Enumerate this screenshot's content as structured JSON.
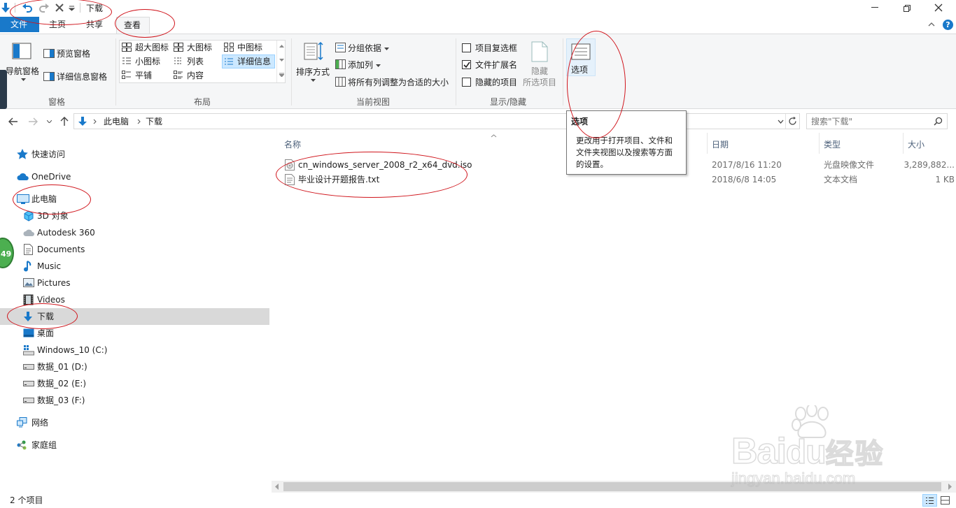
{
  "window": {
    "title": "下载"
  },
  "ribbon_tabs": [
    {
      "label": "文件"
    },
    {
      "label": "主页"
    },
    {
      "label": "共享"
    },
    {
      "label": "查看"
    }
  ],
  "ribbon": {
    "panes_group": {
      "nav_pane": "导航窗格",
      "preview_pane": "预览窗格",
      "details_pane": "详细信息窗格",
      "title": "窗格"
    },
    "layout_group": {
      "items": [
        "超大图标",
        "大图标",
        "中图标",
        "小图标",
        "列表",
        "详细信息",
        "平铺",
        "内容"
      ],
      "title": "布局"
    },
    "current_view_group": {
      "sort_by": "排序方式",
      "group_by": "分组依据",
      "add_columns": "添加列",
      "size_columns": "将所有列调整为合适的大小",
      "title": "当前视图"
    },
    "show_hide_group": {
      "item_checkboxes": "项目复选框",
      "file_extensions": "文件扩展名",
      "hidden_items": "隐藏的项目",
      "hide_label": "隐藏",
      "selected_items": "所选项目",
      "title": "显示/隐藏"
    },
    "options": {
      "label": "选项"
    }
  },
  "address_bar": {
    "segments": [
      "此电脑",
      "下载"
    ]
  },
  "search": {
    "placeholder": "搜索\"下载\""
  },
  "tooltip": {
    "title": "选项",
    "body_line1": "更改用于打开项目、文件和",
    "body_line2": "文件夹视图以及搜索等方面",
    "body_line3": "的设置。"
  },
  "nav_pane": {
    "quick_access": "快速访问",
    "onedrive": "OneDrive",
    "this_pc": "此电脑",
    "items": [
      "3D 对象",
      "Autodesk 360",
      "Documents",
      "Music",
      "Pictures",
      "Videos",
      "下载",
      "桌面",
      "Windows_10 (C:)",
      "数据_01 (D:)",
      "数据_02 (E:)",
      "数据_03 (F:)"
    ],
    "network": "网络",
    "homegroup": "家庭组"
  },
  "columns": {
    "name": "名称",
    "date": "日期",
    "type": "类型",
    "size": "大小"
  },
  "files": [
    {
      "name": "cn_windows_server_2008_r2_x64_dvd.iso",
      "date": "2017/8/16 11:20",
      "type": "光盘映像文件",
      "size": "3,289,882..."
    },
    {
      "name": "毕业设计开题报告.txt",
      "date": "2018/6/8 14:05",
      "type": "文本文档",
      "size": "1 KB"
    }
  ],
  "status_bar": {
    "count": "2 个项目"
  },
  "badge": {
    "value": "49"
  },
  "watermark": {
    "logo": "Baidu经验",
    "url": "jingyan.baidu.com"
  },
  "colors": {
    "accent": "#1979ca",
    "selected": "#d9d9d9",
    "annotation": "#d0151c"
  }
}
